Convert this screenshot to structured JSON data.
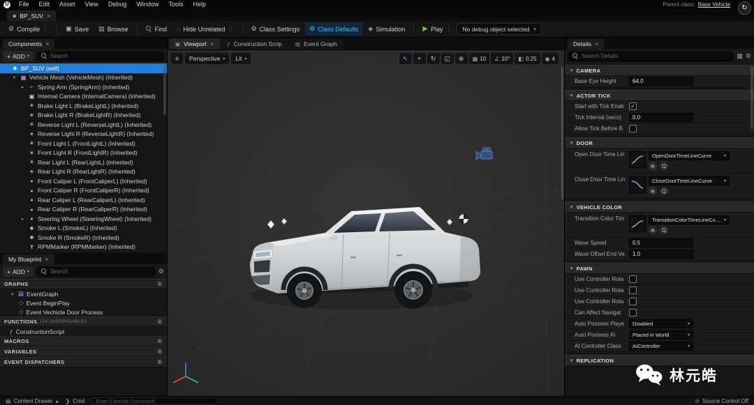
{
  "colors": {
    "selection_blue": "#1f7fd6",
    "mode_active_blue": "#53b4f0",
    "play_green": "#58c758",
    "viewport_bg": "#2b2b2b"
  },
  "menu_bar": {
    "items": [
      "File",
      "Edit",
      "Asset",
      "View",
      "Debug",
      "Window",
      "Tools",
      "Help"
    ],
    "parent_class_label": "Parent class:",
    "parent_class_value": "Base Vehicle"
  },
  "asset_tab": {
    "label": "BP_SUV"
  },
  "toolbar": {
    "compile": "Compile",
    "save": "Save",
    "browse": "Browse",
    "find": "Find",
    "hide_unrelated": "Hide Unrelated",
    "class_settings": "Class Settings",
    "class_defaults": "Class Defaults",
    "simulation": "Simulation",
    "play": "Play",
    "debug_object": "No debug object selected"
  },
  "components_panel": {
    "tab": "Components",
    "add_label": "ADD",
    "search_placeholder": "Search",
    "items": [
      {
        "label": "BP_SUV (self)",
        "icon": "blueprint",
        "indent": 0,
        "arrow": "",
        "selected": true
      },
      {
        "label": "Vehicle Mesh (VehicleMesh) (Inherited)",
        "icon": "skeletal-mesh",
        "indent": 1,
        "arrow": "expanded"
      },
      {
        "label": "Spring Arm (SpringArm) (Inherited)",
        "icon": "spring-arm",
        "indent": 2,
        "arrow": "collapsed"
      },
      {
        "label": "Internal Camera (InternalCamera) (Inherited)",
        "icon": "camera",
        "indent": 2,
        "arrow": ""
      },
      {
        "label": "Brake Light L (BrakeLightL) (Inherited)",
        "icon": "light",
        "indent": 2,
        "arrow": ""
      },
      {
        "label": "Brake Light R (BrakeLightR) (Inherited)",
        "icon": "light",
        "indent": 2,
        "arrow": ""
      },
      {
        "label": "Reverse Light L (ReverseLightL) (Inherited)",
        "icon": "light",
        "indent": 2,
        "arrow": ""
      },
      {
        "label": "Reverse Light R (ReverseLightR) (Inherited)",
        "icon": "light",
        "indent": 2,
        "arrow": ""
      },
      {
        "label": "Front Light L (FrontLightL) (Inherited)",
        "icon": "light",
        "indent": 2,
        "arrow": ""
      },
      {
        "label": "Front Light R (FrontLightR) (Inherited)",
        "icon": "light",
        "indent": 2,
        "arrow": ""
      },
      {
        "label": "Rear Light L (RearLightL) (Inherited)",
        "icon": "light",
        "indent": 2,
        "arrow": ""
      },
      {
        "label": "Rear Light R (RearLightR) (Inherited)",
        "icon": "light",
        "indent": 2,
        "arrow": ""
      },
      {
        "label": "Front Caliper L (FrontCaliperL) (Inherited)",
        "icon": "static-mesh",
        "indent": 2,
        "arrow": ""
      },
      {
        "label": "Front Caliper R (FrontCaliperR) (Inherited)",
        "icon": "static-mesh",
        "indent": 2,
        "arrow": ""
      },
      {
        "label": "Rear Caliper L (RearCaliperL) (Inherited)",
        "icon": "static-mesh",
        "indent": 2,
        "arrow": ""
      },
      {
        "label": "Rear Caliper R (RearCaliperR) (Inherited)",
        "icon": "static-mesh",
        "indent": 2,
        "arrow": ""
      },
      {
        "label": "Steering Wheel (SteeringWheel) (Inherited)",
        "icon": "static-mesh",
        "indent": 2,
        "arrow": "collapsed"
      },
      {
        "label": "Smoke L (SmokeL) (Inherited)",
        "icon": "particle",
        "indent": 2,
        "arrow": ""
      },
      {
        "label": "Smoke R (SmokeR) (Inherited)",
        "icon": "particle",
        "indent": 2,
        "arrow": ""
      },
      {
        "label": "RPMMarker (RPMMarker) (Inherited)",
        "icon": "text-render",
        "indent": 2,
        "arrow": ""
      }
    ]
  },
  "my_blueprint": {
    "tab": "My Blueprint",
    "add_label": "ADD",
    "search_placeholder": "Search",
    "graphs_title": "GRAPHS",
    "event_graph": "EventGraph",
    "event_begin_play": "Event BeginPlay",
    "event_door": "Event Vechicle Door Process",
    "functions_title": "FUNCTIONS",
    "functions_badge": "(24 OVERRIDABLE)",
    "construction_script": "ConstructionScript",
    "macros_title": "MACROS",
    "variables_title": "VARIABLES",
    "dispatchers_title": "EVENT DISPATCHERS"
  },
  "viewport": {
    "tab_viewport": "Viewport",
    "tab_construction": "Construction Scrip",
    "tab_event_graph": "Event Graph",
    "perspective": "Perspective",
    "lit": "Lit",
    "grid_snap": "10",
    "rotation_snap": "10°",
    "scale_snap": "0.25",
    "camera_speed": "4"
  },
  "details": {
    "tab": "Details",
    "search_placeholder": "Search Details",
    "camera": {
      "title": "CAMERA",
      "base_eye_height_label": "Base Eye Height",
      "base_eye_height": "64.0"
    },
    "actor_tick": {
      "title": "ACTOR TICK",
      "start_tick_label": "Start with Tick Enab",
      "tick_interval_label": "Tick Interval (secs)",
      "tick_interval": "0.0",
      "allow_tick_label": "Allow Tick Before B"
    },
    "door": {
      "title": "DOOR",
      "open_label": "Open Door Time Lin",
      "open_value": "OpenDoorTimeLineCurve",
      "close_label": "Close Door Time Lin",
      "close_value": "CloseDoorTimeLineCurve"
    },
    "vehicle_color": {
      "title": "VEHICLE COLOR",
      "transition_label": "Transition Color Tim",
      "transition_value": "TransitionColorTimeLineCurve",
      "wave_speed_label": "Wave Speed",
      "wave_speed": "0.5",
      "wave_offset_label": "Wave Offset End Va",
      "wave_offset": "1.0"
    },
    "pawn": {
      "title": "PAWN",
      "use_ctrl_rot_label": "Use Controller Rota",
      "can_affect_label": "Can Affect Navigat",
      "auto_possess_player_label": "Auto Possess Playe",
      "auto_possess_player": "Disabled",
      "auto_possess_ai_label": "Auto Possess AI",
      "auto_possess_ai": "Placed in World",
      "ai_controller_label": "AI Controller Class",
      "ai_controller": "AIController"
    },
    "replication": {
      "title": "REPLICATION"
    }
  },
  "status_bar": {
    "content_drawer": "Content Drawer",
    "cmd": "Cmd",
    "console_placeholder": "Enter Console Command",
    "source_control": "Source Control Off"
  },
  "watermark": {
    "text": "林元皓"
  }
}
